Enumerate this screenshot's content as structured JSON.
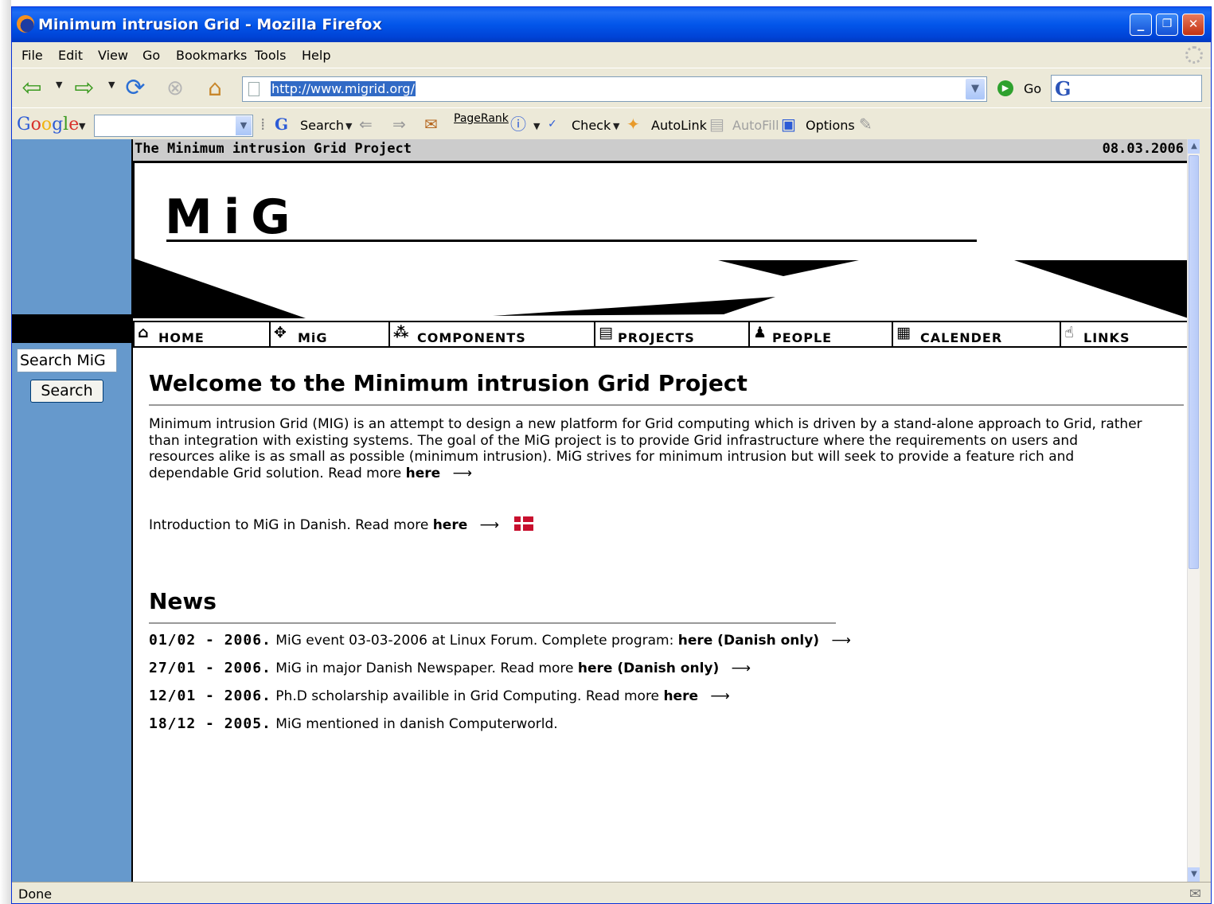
{
  "window": {
    "title": "Minimum intrusion Grid - Mozilla Firefox",
    "controls": {
      "minimize": "_",
      "restore": "❐",
      "close": "✕"
    }
  },
  "menu": [
    "File",
    "Edit",
    "View",
    "Go",
    "Bookmarks",
    "Tools",
    "Help"
  ],
  "navbar": {
    "url": "http://www.migrid.org/",
    "go_label": "Go"
  },
  "google_toolbar": {
    "logo": "Google",
    "search_label": "Search",
    "pagerank_label": "PageRank",
    "check_label": "Check",
    "autolink_label": "AutoLink",
    "autofill_label": "AutoFill",
    "options_label": "Options"
  },
  "page": {
    "header_title": "The Minimum intrusion Grid Project",
    "header_date": "08.03.2006",
    "logo_text": "MiG",
    "sidebar": {
      "search_value": "Search MiG",
      "search_button": "Search"
    },
    "nav_tabs": [
      {
        "label": "HOME",
        "icon": "home-icon"
      },
      {
        "label": "MiG",
        "icon": "grid-icon"
      },
      {
        "label": "COMPONENTS",
        "icon": "components-icon"
      },
      {
        "label": "PROJECTS",
        "icon": "projects-icon"
      },
      {
        "label": "PEOPLE",
        "icon": "people-icon"
      },
      {
        "label": "CALENDER",
        "icon": "calendar-icon"
      },
      {
        "label": "LINKS",
        "icon": "links-icon"
      }
    ],
    "welcome_title": "Welcome to the Minimum intrusion Grid Project",
    "intro_text": "Minimum intrusion Grid (MIG) is an attempt to design a new platform for Grid computing which is driven by a stand-alone approach to Grid, rather than integration with existing systems. The goal of the MiG project is to provide Grid infrastructure where the requirements on users and resources alike is as small as possible (minimum intrusion). MiG strives for minimum intrusion but will seek to provide a feature rich and dependable Grid solution. Read more",
    "intro_link": "here",
    "danish_text": "Introduction to MiG in Danish. Read more",
    "danish_link": "here",
    "news_title": "News",
    "news": [
      {
        "date": "01/02 - 2006.",
        "text": "MiG event 03-03-2006 at Linux Forum. Complete program:",
        "link": "here (Danish only)"
      },
      {
        "date": "27/01 - 2006.",
        "text": "MiG in major Danish Newspaper. Read more",
        "link": "here (Danish only)"
      },
      {
        "date": "12/01 - 2006.",
        "text": "Ph.D scholarship availible in Grid Computing. Read more",
        "link": "here"
      },
      {
        "date": "18/12 - 2005.",
        "text": "MiG mentioned in danish Computerworld.",
        "link": ""
      }
    ]
  },
  "status": {
    "text": "Done"
  },
  "colors": {
    "sidebar": "#6699cc",
    "titlebar": "#0256ea",
    "chrome": "#ece9d8"
  }
}
